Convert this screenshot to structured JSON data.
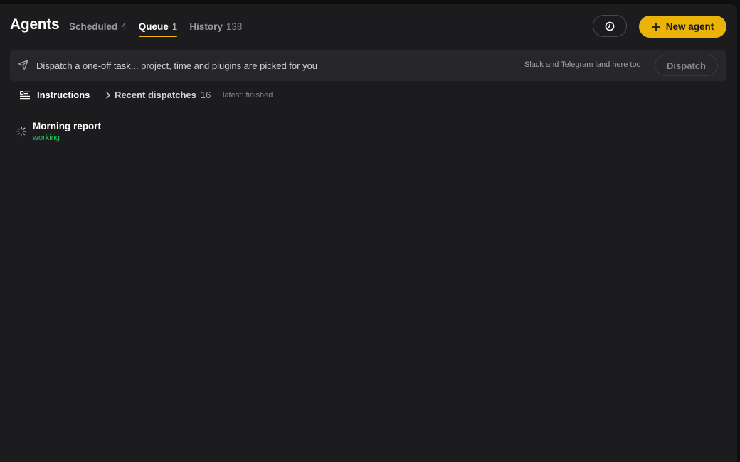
{
  "header": {
    "title": "Agents",
    "tabs": [
      {
        "label": "Scheduled",
        "count": "4",
        "active": false
      },
      {
        "label": "Queue",
        "count": "1",
        "active": true
      },
      {
        "label": "History",
        "count": "138",
        "active": false
      }
    ],
    "new_agent_label": "New agent",
    "accent_color": "#eab308"
  },
  "dispatch": {
    "placeholder": "Dispatch a one-off task... project, time and plugins are picked for you",
    "hint": "Slack and Telegram land here too",
    "button_label": "Dispatch"
  },
  "subbar": {
    "instructions_label": "Instructions",
    "recent_label": "Recent dispatches",
    "recent_count": "16",
    "latest_status": "latest: finished"
  },
  "queue": {
    "items": [
      {
        "name": "Morning report",
        "status": "working",
        "status_color": "#22c55e"
      }
    ]
  },
  "icons": {
    "clock": "clock-icon",
    "plus": "plus-icon",
    "send": "send-icon",
    "instructions": "list-icon",
    "chevron": "chevron-right-icon",
    "spinner": "spinner-icon"
  }
}
